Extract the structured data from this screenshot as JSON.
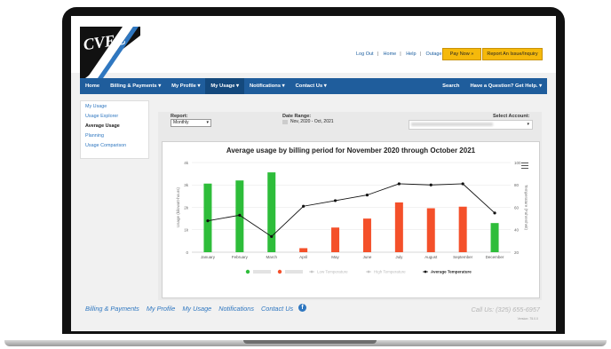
{
  "header": {
    "logo_text": "CVEC",
    "links": [
      "Log Out",
      "Home",
      "Help",
      "Outage Map"
    ],
    "pay_button": "Pay Now »",
    "report_button": "Report An Issue/Inquiry"
  },
  "nav": {
    "items": [
      {
        "label": "Home"
      },
      {
        "label": "Billing & Payments ▾"
      },
      {
        "label": "My Profile ▾"
      },
      {
        "label": "My Usage ▾"
      },
      {
        "label": "Notifications ▾"
      },
      {
        "label": "Contact Us ▾"
      }
    ],
    "search": "Search",
    "question": "Have a Question? Get Help. ▾"
  },
  "sidebar": {
    "items": [
      {
        "label": "My Usage"
      },
      {
        "label": "Usage Explorer"
      },
      {
        "label": "Average Usage"
      },
      {
        "label": "Planning"
      },
      {
        "label": "Usage Comparison"
      }
    ]
  },
  "controls": {
    "report_label": "Report:",
    "report_value": "Monthly",
    "date_label": "Date Range:",
    "date_value": "Nov, 2020 - Oct, 2021",
    "account_label": "Select Account:"
  },
  "chart_data": {
    "type": "bar",
    "title": "Average usage by billing period for November 2020 through October 2021",
    "ylabel": "Usage (kilowatt-hours)",
    "y2label": "Temperature (Fahrenheit)",
    "categories": [
      "January",
      "February",
      "March",
      "April",
      "May",
      "June",
      "July",
      "August",
      "September",
      "December"
    ],
    "ylim": [
      0,
      4
    ],
    "y_ticks": [
      "0",
      "1k",
      "2k",
      "3k",
      "4k"
    ],
    "y2lim": [
      20,
      100
    ],
    "y2_ticks": [
      "20",
      "40",
      "60",
      "80",
      "100"
    ],
    "series": [
      {
        "name": "",
        "type": "bar",
        "color": "#2ebd3a",
        "values": [
          3060,
          3200,
          3560,
          null,
          null,
          null,
          null,
          null,
          null,
          1300
        ]
      },
      {
        "name": "",
        "type": "bar",
        "color": "#f4502a",
        "values": [
          null,
          null,
          null,
          180,
          1100,
          1500,
          2220,
          1960,
          2030,
          null
        ]
      },
      {
        "name": "Low Temperature",
        "type": "line",
        "color": "#cccccc",
        "hidden": true
      },
      {
        "name": "High Temperature",
        "type": "line",
        "color": "#cccccc",
        "hidden": true
      },
      {
        "name": "Average Temperature",
        "type": "line",
        "color": "#111111",
        "values": [
          48,
          53,
          34,
          61,
          66,
          71,
          81,
          80,
          81,
          55
        ]
      }
    ],
    "grid": true,
    "legend": "bottom"
  },
  "footer": {
    "links": [
      "Billing & Payments",
      "My Profile",
      "My Usage",
      "Notifications",
      "Contact Us"
    ],
    "facebook_icon": "f",
    "call": "Call Us: (325) 655-6957",
    "version": "Version: 75.0.0"
  }
}
